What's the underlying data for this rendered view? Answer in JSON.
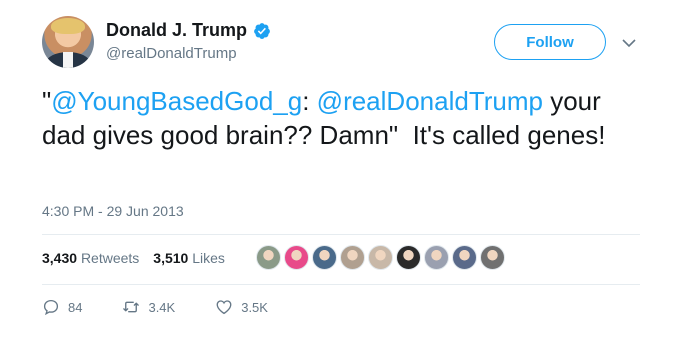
{
  "user": {
    "name": "Donald J. Trump",
    "handle": "@realDonaldTrump",
    "follow_label": "Follow"
  },
  "tweet": {
    "quote_open": "\"",
    "mention1": "@YoungBasedGod_g",
    "colon": ": ",
    "mention2": "@realDonaldTrump",
    "text_rest": " your dad gives good brain?? Damn\"  It's called genes!",
    "timestamp": "4:30 PM - 29 Jun 2013"
  },
  "stats": {
    "retweets_count": "3,430",
    "retweets_label": "Retweets",
    "likes_count": "3,510",
    "likes_label": "Likes"
  },
  "likers": [
    "#8a9a88",
    "#e84a8a",
    "#4a6a8a",
    "#b0a090",
    "#c8b8a8",
    "#2a2a2a",
    "#9aa0b0",
    "#5a6a8a",
    "#707070"
  ],
  "actions": {
    "replies": "84",
    "retweets": "3.4K",
    "likes": "3.5K"
  },
  "colors": {
    "accent": "#1da1f2",
    "text": "#14171a",
    "secondary": "#657786"
  }
}
